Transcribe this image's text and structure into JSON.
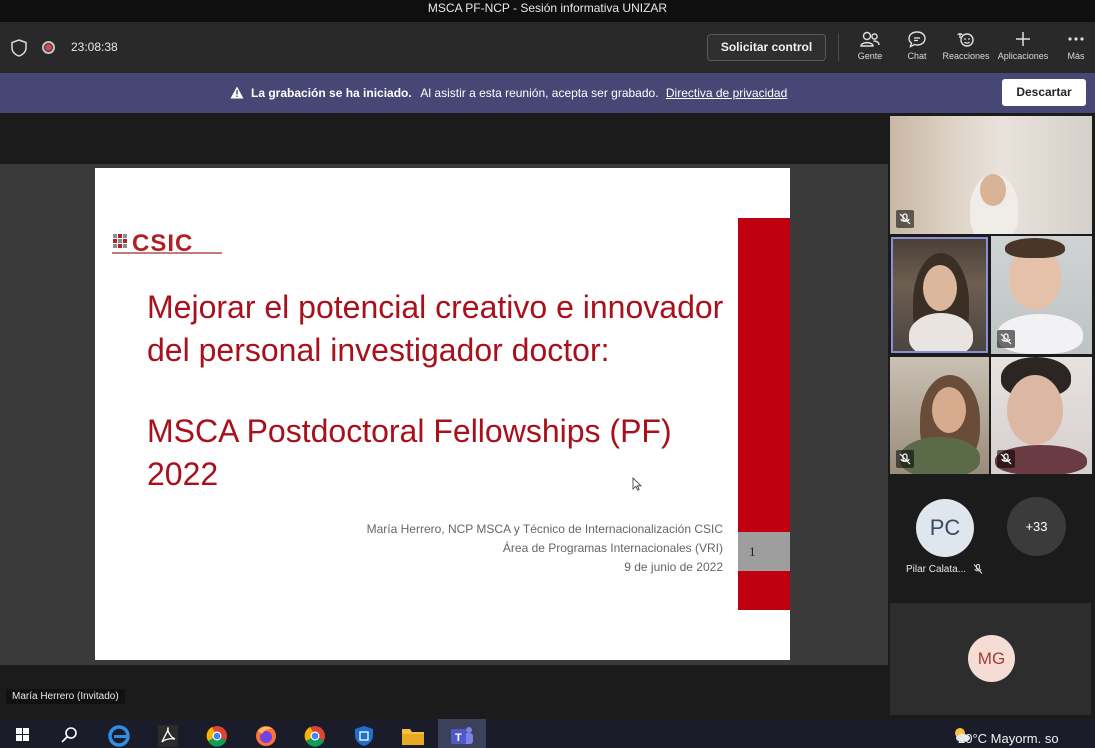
{
  "window": {
    "title": "MSCA PF-NCP - Sesión informativa UNIZAR"
  },
  "toolbar": {
    "timer": "23:08:38",
    "request_control": "Solicitar control",
    "items": [
      {
        "label": "Gente",
        "icon": "people-icon"
      },
      {
        "label": "Chat",
        "icon": "chat-icon"
      },
      {
        "label": "Reacciones",
        "icon": "reactions-icon"
      },
      {
        "label": "Aplicaciones",
        "icon": "plus-icon"
      },
      {
        "label": "Más",
        "icon": "more-icon"
      }
    ]
  },
  "banner": {
    "bold": "La grabación se ha iniciado.",
    "text": "Al asistir a esta reunión, acepta ser grabado.",
    "link": "Directiva de privacidad",
    "dismiss": "Descartar",
    "color": "#464775"
  },
  "slide": {
    "logo": "CSIC",
    "title_line1": "Mejorar el potencial creativo e innovador",
    "title_line2": "del personal investigador doctor:",
    "title_line3": "MSCA Postdoctoral Fellowships (PF) 2022",
    "author": "María Herrero, NCP MSCA y Técnico de Internacionalización CSIC",
    "department": "Área de Programas Internacionales (VRI)",
    "date": "9 de junio de 2022",
    "page_number": "1",
    "accent_color": "#c00011"
  },
  "presenter": {
    "label": "María Herrero (Invitado)"
  },
  "participants": {
    "pc": {
      "initials": "PC",
      "name": "Pilar Calata..."
    },
    "overflow": "+33",
    "mg": {
      "initials": "MG"
    }
  },
  "system": {
    "weather": "20°C  Mayorm. so"
  }
}
